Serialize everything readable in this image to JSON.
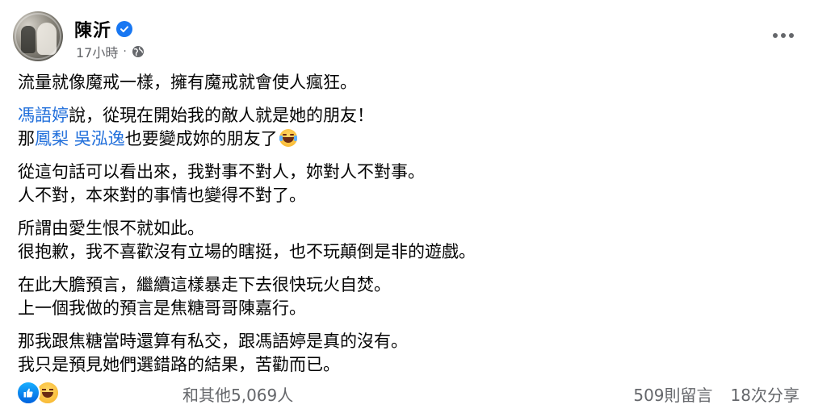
{
  "post": {
    "author": {
      "name": "陳沂",
      "verified": true,
      "avatar_icon": "profile-photo",
      "verified_icon": "verified-badge-icon"
    },
    "timestamp": "17小時",
    "separator": "·",
    "privacy_icon": "globe-icon",
    "more_icon": "more-options-icon",
    "body": {
      "p1": {
        "l1": "流量就像魔戒一樣，擁有魔戒就會使人瘋狂。"
      },
      "p2": {
        "l1_mention": "馮語婷",
        "l1_rest": "說，從現在開始我的敵人就是她的朋友！",
        "l2_pre": "那",
        "l2_mention1": "鳳梨",
        "l2_space": " ",
        "l2_mention2": "吳泓逸",
        "l2_rest": "也要變成妳的朋友了",
        "l2_emoji": "tears-of-joy-emoji"
      },
      "p3": {
        "l1": "從這句話可以看出來，我對事不對人，妳對人不對事。",
        "l2": "人不對，本來對的事情也變得不對了。"
      },
      "p4": {
        "l1": "所謂由愛生恨不就如此。",
        "l2": "很抱歉，我不喜歡沒有立場的瞎挺，也不玩顛倒是非的遊戲。"
      },
      "p5": {
        "l1": "在此大膽預言，繼續這樣暴走下去很快玩火自焚。",
        "l2": "上一個我做的預言是焦糖哥哥陳嘉行。"
      },
      "p6": {
        "l1": "那我跟焦糖當時還算有私交，跟馮語婷是真的沒有。",
        "l2": "我只是預見她們選錯路的結果，苦勸而已。"
      }
    },
    "footer": {
      "reactions": [
        "like-icon",
        "haha-icon"
      ],
      "reaction_count": "和其他5,069人",
      "comments": "509則留言",
      "shares": "18次分享"
    },
    "colors": {
      "mention": "#216fdb",
      "secondary_text": "#65676b",
      "verified": "#1877f2"
    }
  }
}
